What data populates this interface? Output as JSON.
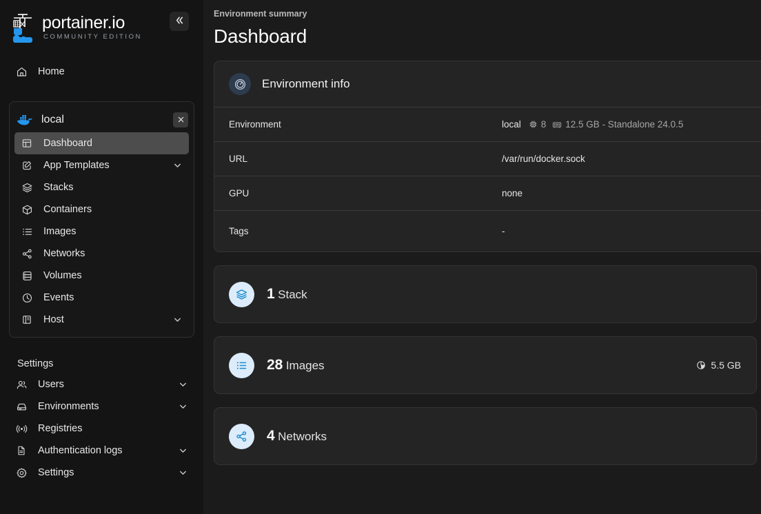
{
  "brand": {
    "name": "portainer.io",
    "edition": "COMMUNITY EDITION",
    "logo_icon": "portainer-crane-logo",
    "collapse_icon": "chevron-double-left-icon"
  },
  "sidebar": {
    "home": {
      "label": "Home",
      "icon": "home-icon"
    },
    "environment": {
      "name": "local",
      "icon": "docker-whale-icon",
      "close_icon": "close-icon",
      "items": [
        {
          "label": "Dashboard",
          "icon": "dashboard-layout-icon",
          "active": true,
          "expandable": false
        },
        {
          "label": "App Templates",
          "icon": "edit-square-icon",
          "active": false,
          "expandable": true
        },
        {
          "label": "Stacks",
          "icon": "layers-icon",
          "active": false,
          "expandable": false
        },
        {
          "label": "Containers",
          "icon": "box-icon",
          "active": false,
          "expandable": false
        },
        {
          "label": "Images",
          "icon": "list-icon",
          "active": false,
          "expandable": false
        },
        {
          "label": "Networks",
          "icon": "share-network-icon",
          "active": false,
          "expandable": false
        },
        {
          "label": "Volumes",
          "icon": "database-icon",
          "active": false,
          "expandable": false
        },
        {
          "label": "Events",
          "icon": "clock-icon",
          "active": false,
          "expandable": false
        },
        {
          "label": "Host",
          "icon": "server-panel-icon",
          "active": false,
          "expandable": true
        }
      ]
    },
    "settings_section": {
      "title": "Settings",
      "items": [
        {
          "label": "Users",
          "icon": "users-icon",
          "expandable": true
        },
        {
          "label": "Environments",
          "icon": "server-icon",
          "expandable": true
        },
        {
          "label": "Registries",
          "icon": "radio-icon",
          "expandable": false
        },
        {
          "label": "Authentication logs",
          "icon": "document-icon",
          "expandable": true
        },
        {
          "label": "Settings",
          "icon": "gear-icon",
          "expandable": true
        }
      ]
    }
  },
  "main": {
    "breadcrumb": "Environment summary",
    "title": "Dashboard",
    "environment_info": {
      "heading": "Environment info",
      "heading_icon": "gauge-icon",
      "rows": [
        {
          "key": "Environment",
          "value": "local",
          "cpu_icon": "cpu-icon",
          "cpu": "8",
          "memory_icon": "memory-icon",
          "memory": "12.5 GB - Standalone 24.0.5"
        },
        {
          "key": "URL",
          "value": "/var/run/docker.sock"
        },
        {
          "key": "GPU",
          "value": "none"
        },
        {
          "key": "Tags",
          "value": "-"
        }
      ]
    },
    "stats": [
      {
        "count": "1",
        "label": "Stack",
        "icon": "layers-icon",
        "extra": null,
        "extra_icon": null
      },
      {
        "count": "28",
        "label": "Images",
        "icon": "list-icon",
        "extra": "5.5 GB",
        "extra_icon": "pie-chart-icon"
      },
      {
        "count": "4",
        "label": "Networks",
        "icon": "share-network-icon",
        "extra": null,
        "extra_icon": null
      }
    ]
  },
  "colors": {
    "accent_blue": "#1f8fd1",
    "sidebar_bg": "#141414",
    "main_bg": "#1b1b1b",
    "card_bg": "#242424",
    "active_nav": "#4d4d4d"
  }
}
